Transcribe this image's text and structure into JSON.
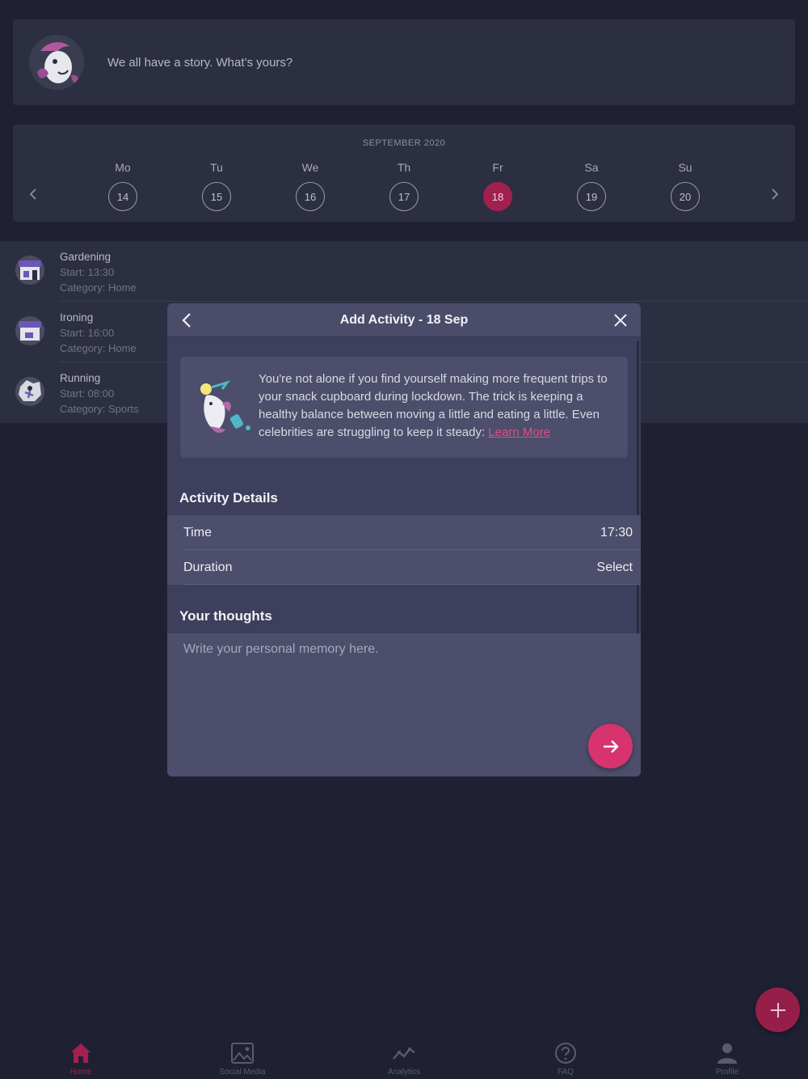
{
  "story": {
    "prompt": "We all have a story. What’s yours?"
  },
  "calendar": {
    "month": "SEPTEMBER 2020",
    "days": [
      {
        "dow": "Mo",
        "date": "14"
      },
      {
        "dow": "Tu",
        "date": "15"
      },
      {
        "dow": "We",
        "date": "16"
      },
      {
        "dow": "Th",
        "date": "17"
      },
      {
        "dow": "Fr",
        "date": "18",
        "selected": true
      },
      {
        "dow": "Sa",
        "date": "19"
      },
      {
        "dow": "Su",
        "date": "20"
      }
    ]
  },
  "activities": [
    {
      "name": "Gardening",
      "start": "Start: 13:30",
      "category": "Category: Home"
    },
    {
      "name": "Ironing",
      "start": "Start: 16:00",
      "category": "Category: Home"
    },
    {
      "name": "Running",
      "start": "Start: 08:00",
      "category": "Category: Sports"
    }
  ],
  "modal": {
    "title": "Add Activity - 18 Sep",
    "info_text": "You're not alone if you find yourself making more frequent trips to your snack cupboard during lockdown. The trick is keeping a healthy balance between moving a little and eating a little. Even celebrities are struggling to keep it steady: ",
    "info_link": "Learn More",
    "details_title": "Activity Details",
    "time_label": "Time",
    "time_value": "17:30",
    "duration_label": "Duration",
    "duration_value": "Select",
    "thoughts_title": "Your thoughts",
    "thoughts_placeholder": "Write your personal memory here."
  },
  "tabs": [
    {
      "label": "Home",
      "icon": "home-icon",
      "active": true
    },
    {
      "label": "Social Media",
      "icon": "image-icon"
    },
    {
      "label": "Analytics",
      "icon": "analytics-icon"
    },
    {
      "label": "FAQ",
      "icon": "help-icon"
    },
    {
      "label": "Profile",
      "icon": "person-icon"
    }
  ],
  "colors": {
    "background": "#1f2133",
    "card": "#2c2e42",
    "modal": "#3d3f5c",
    "accent": "#d6336f",
    "selected_date": "#a0214f"
  }
}
